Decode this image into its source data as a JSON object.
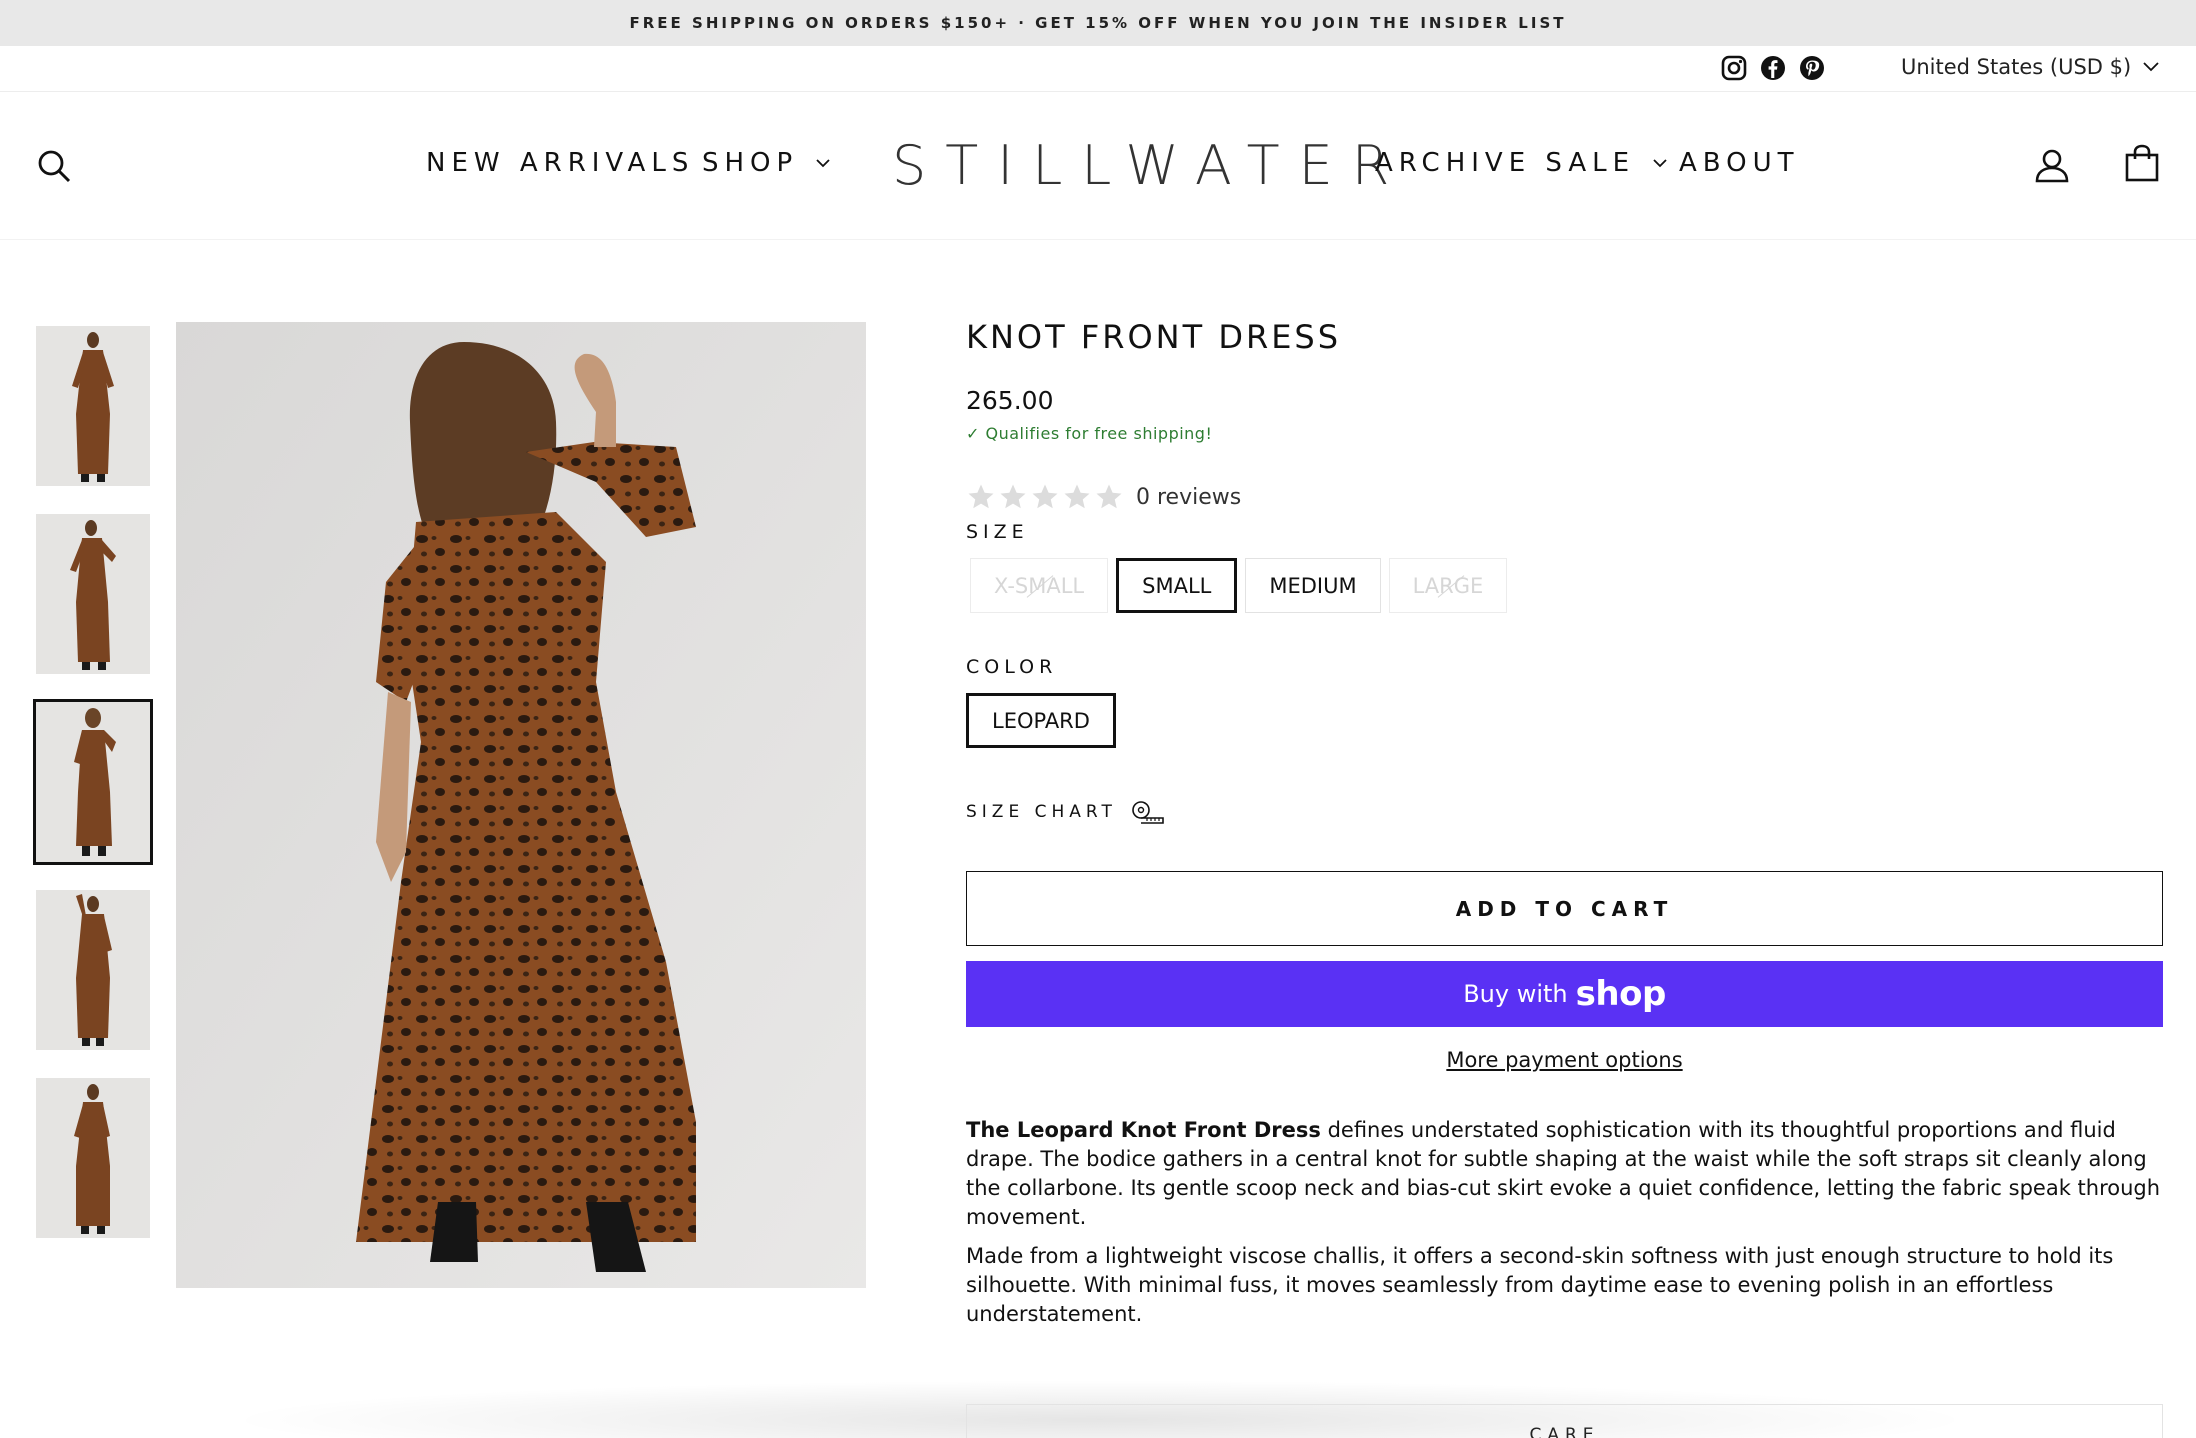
{
  "announcement": "FREE SHIPPING ON ORDERS $150+ · GET 15% OFF WHEN YOU JOIN THE INSIDER LIST",
  "utility": {
    "social_icons": [
      "instagram-icon",
      "facebook-icon",
      "pinterest-icon"
    ],
    "country_selector": "United States (USD $)"
  },
  "header": {
    "logo": "STILLWATER",
    "nav_left": [
      {
        "label": "NEW ARRIVALS",
        "dropdown": false
      },
      {
        "label": "SHOP",
        "dropdown": true
      }
    ],
    "nav_right": [
      {
        "label": "ARCHIVE SALE",
        "dropdown": true
      },
      {
        "label": "ABOUT",
        "dropdown": false
      }
    ],
    "icons": [
      "search-icon",
      "account-icon",
      "cart-icon"
    ]
  },
  "gallery": {
    "thumbnail_count": 5,
    "active_index": 2
  },
  "product": {
    "title": "KNOT FRONT DRESS",
    "price": "265.00",
    "shipping_note": "✓ Qualifies for free shipping!",
    "rating_count": "0 reviews",
    "stars": 5,
    "size_label": "SIZE",
    "sizes": [
      {
        "label": "X-SMALL",
        "state": "disabled"
      },
      {
        "label": "SMALL",
        "state": "selected"
      },
      {
        "label": "MEDIUM",
        "state": "available"
      },
      {
        "label": "LARGE",
        "state": "disabled"
      }
    ],
    "color_label": "COLOR",
    "colors": [
      {
        "label": "LEOPARD",
        "state": "selected"
      }
    ],
    "size_chart": "SIZE CHART",
    "add_to_cart": "ADD TO CART",
    "buy_with": "Buy with",
    "shop_brand": "shop",
    "more_payment": "More payment options",
    "description_bold": "The Leopard Knot Front Dress",
    "description_p1": " defines understated sophistication with its thoughtful proportions and fluid drape. The bodice gathers in a central knot for subtle shaping at the waist while the soft straps sit cleanly along the collarbone. Its gentle scoop neck and bias-cut skirt evoke a quiet confidence, letting the fabric speak through movement.",
    "description_p2": "Made from a lightweight viscose challis, it offers a second-skin softness with just enough structure to hold its silhouette. With minimal fuss, it moves seamlessly from daytime ease to evening polish in an effortless understatement.",
    "care_label": "CARE"
  },
  "colors": {
    "announcement_bg": "#e8e8e8",
    "shop_pay": "#5a31f4",
    "free_shipping_green": "#2e7d32",
    "star_empty": "#dcdcdc"
  }
}
